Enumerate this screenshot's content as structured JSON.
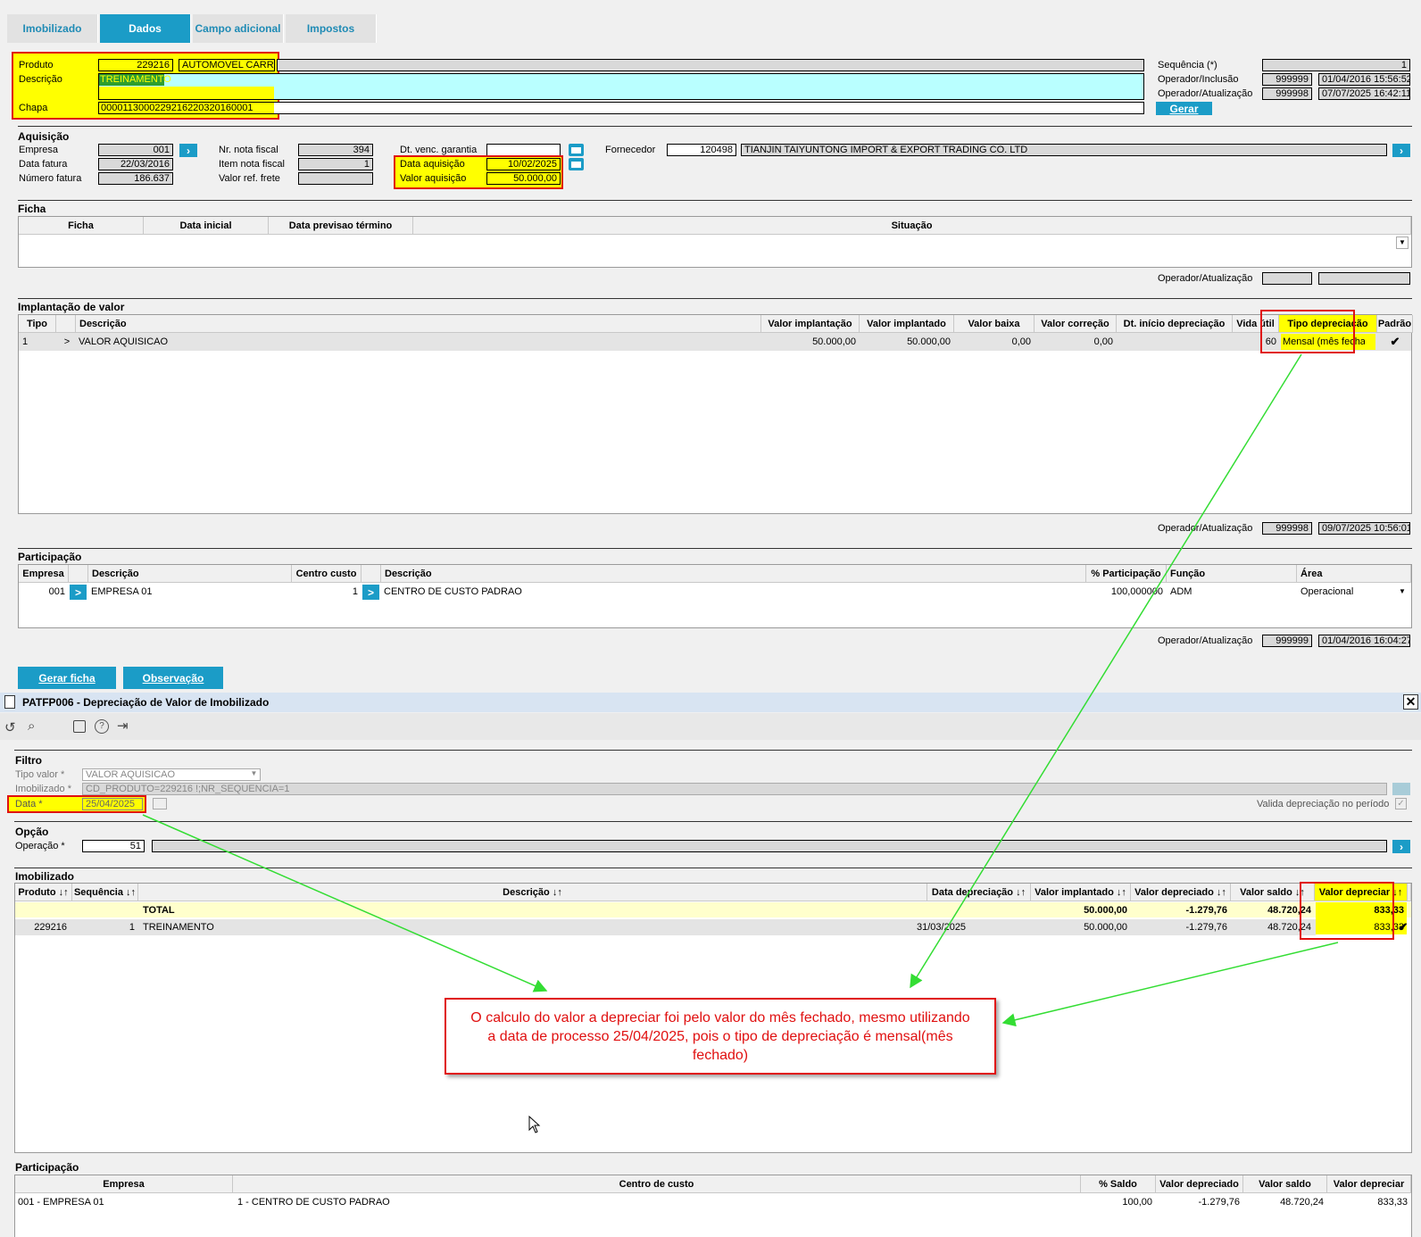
{
  "tabs": [
    "Imobilizado",
    "Dados",
    "Campo adicional",
    "Impostos"
  ],
  "top": {
    "produto_label": "Produto",
    "produto_code": "229216",
    "produto_name": "AUTOMOVEL CARRO",
    "descricao_label": "Descrição",
    "descricao_value": "TREINAMENTO",
    "chapa_label": "Chapa",
    "chapa_value": "000011300022921622032016000​1",
    "sequencia_label": "Sequência (*)",
    "sequencia_value": "1",
    "op_inclusao_label": "Operador/Inclusão",
    "op_inclusao_id": "999999",
    "op_inclusao_date": "01/04/2016 15:56:52",
    "op_atualizacao_label": "Operador/Atualização",
    "op_atualizacao_id": "999998",
    "op_atualizacao_date": "07/07/2025 16:42:11",
    "gerar_label": "Gerar"
  },
  "aquisicao": {
    "title": "Aquisição",
    "empresa_label": "Empresa",
    "empresa": "001",
    "data_fatura_label": "Data fatura",
    "data_fatura": "22/03/2016",
    "numero_fatura_label": "Número fatura",
    "numero_fatura": "186.637",
    "nr_nota_label": "Nr. nota fiscal",
    "nr_nota": "394",
    "item_nota_label": "Item nota fiscal",
    "item_nota": "1",
    "valor_frete_label": "Valor ref. frete",
    "valor_frete": "",
    "dt_garantia_label": "Dt. venc. garantia",
    "dt_garantia": "",
    "data_aquisicao_label": "Data aquisição",
    "data_aquisicao": "10/02/2025",
    "valor_aquisicao_label": "Valor aquisição",
    "valor_aquisicao": "50.000,00",
    "fornecedor_label": "Fornecedor",
    "fornecedor_code": "120498",
    "fornecedor_name": "TIANJIN TAIYUNTONG IMPORT & EXPORT TRADING CO. LTD"
  },
  "ficha": {
    "title": "Ficha",
    "headers": [
      "Ficha",
      "Data inicial",
      "Data previsao término",
      "Situação"
    ],
    "op_label": "Operador/Atualização"
  },
  "implantacao": {
    "title": "Implantação de valor",
    "headers": [
      "Tipo",
      "",
      "Descrição",
      "Valor implantação",
      "Valor implantado",
      "Valor baixa",
      "Valor correção",
      "Dt. início depreciação",
      "Vida útil",
      "Tipo depreciação",
      "Padrão"
    ],
    "row": {
      "tipo": "1",
      "arrow": ">",
      "descricao": "VALOR AQUISICAO",
      "valor_implantacao": "50.000,00",
      "valor_implantado": "50.000,00",
      "valor_baixa": "0,00",
      "valor_correcao": "0,00",
      "dt_inicio": "",
      "vida_util": "60",
      "tipo_depreciacao": "Mensal (mês fecha",
      "padrao": "✔"
    },
    "op_label": "Operador/Atualização",
    "op_id": "999998",
    "op_date": "09/07/2025 10:56:01"
  },
  "participacao": {
    "title": "Participação",
    "headers": [
      "Empresa",
      "",
      "Descrição",
      "Centro custo",
      "",
      "Descrição",
      "% Participação",
      "Função",
      "Área"
    ],
    "row": {
      "empresa": "001",
      "descricao": "EMPRESA 01",
      "centro": "1",
      "centro_desc": "CENTRO DE CUSTO PADRAO",
      "participacao": "100,000000",
      "funcao": "ADM",
      "area": "Operacional"
    },
    "op_label": "Operador/Atualização",
    "op_id": "999999",
    "op_date": "01/04/2016 16:04:27"
  },
  "buttons": {
    "gerar_ficha": "Gerar ficha",
    "observacao": "Observação"
  },
  "dialog": {
    "title": "PATFP006 - Depreciação de Valor de Imobilizado",
    "filtro_title": "Filtro",
    "tipo_valor_label": "Tipo valor *",
    "tipo_valor": "VALOR AQUISICAO",
    "imobilizado_label": "Imobilizado *",
    "imobilizado": "CD_PRODUTO=229216 !;NR_SEQUENCIA=1",
    "data_label": "Data *",
    "data": "25/04/2025",
    "valida_label": "Valida depreciação no período",
    "opcao_title": "Opção",
    "operacao_label": "Operação *",
    "operacao": "51",
    "imobilizado_title": "Imobilizado",
    "headers": [
      "Produto ↓↑",
      "Sequência ↓↑",
      "Descrição ↓↑",
      "Data depreciação ↓↑",
      "Valor implantado ↓↑",
      "Valor depreciado ↓↑",
      "Valor saldo ↓↑",
      "Valor depreciar ↓↑",
      "[ ]"
    ],
    "total": {
      "label": "TOTAL",
      "valor_implantado": "50.000,00",
      "valor_depreciado": "-1.279,76",
      "valor_saldo": "48.720,24",
      "valor_depreciar": "833,33"
    },
    "row": {
      "produto": "229216",
      "sequencia": "1",
      "descricao": "TREINAMENTO",
      "data": "31/03/2025",
      "valor_implantado": "50.000,00",
      "valor_depreciado": "-1.279,76",
      "valor_saldo": "48.720,24",
      "valor_depreciar": "833,33"
    },
    "part_title": "Participação",
    "part_headers": [
      "Empresa",
      "Centro de custo",
      "% Saldo",
      "Valor depreciado",
      "Valor saldo",
      "Valor depreciar"
    ],
    "part_row": {
      "empresa": "001 - EMPRESA 01",
      "centro": "1 - CENTRO DE CUSTO PADRAO",
      "saldo": "100,00",
      "valor_depreciado": "-1.279,76",
      "valor_saldo": "48.720,24",
      "valor_depreciar": "833,33"
    }
  },
  "annotation": "O calculo do valor a depreciar foi pelo valor do mês fechado, mesmo utilizando a data de processo 25/04/2025, pois o tipo de depreciação é mensal(mês fechado)",
  "colors": {
    "accent": "#1b9cc7",
    "highlight": "#ffff00",
    "annotation_red": "#e01010",
    "arrow_green": "#33dd33"
  }
}
